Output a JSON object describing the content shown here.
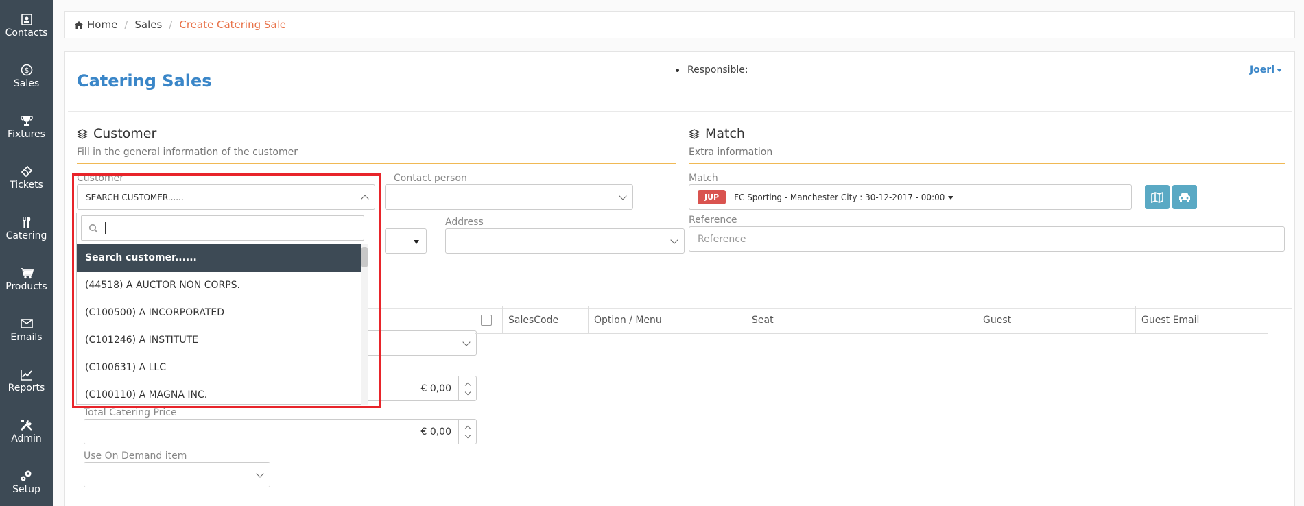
{
  "sidebar": {
    "items": [
      {
        "label": "Contacts",
        "icon": "contact-book-icon"
      },
      {
        "label": "Sales",
        "icon": "dollar-icon"
      },
      {
        "label": "Fixtures",
        "icon": "trophy-icon"
      },
      {
        "label": "Tickets",
        "icon": "ticket-icon"
      },
      {
        "label": "Catering",
        "icon": "cutlery-icon"
      },
      {
        "label": "Products",
        "icon": "cart-icon"
      },
      {
        "label": "Emails",
        "icon": "envelope-icon"
      },
      {
        "label": "Reports",
        "icon": "chart-icon"
      },
      {
        "label": "Admin",
        "icon": "tools-icon"
      },
      {
        "label": "Setup",
        "icon": "gears-icon"
      }
    ]
  },
  "breadcrumb": {
    "home": "Home",
    "sales": "Sales",
    "current": "Create Catering Sale"
  },
  "header": {
    "title": "Catering Sales",
    "responsible_label": "Responsible:",
    "user": "Joeri"
  },
  "customer_section": {
    "title": "Customer",
    "subtitle": "Fill in the general information of the customer",
    "customer_label": "Customer",
    "customer_value": "SEARCH CUSTOMER......",
    "contact_label": "Contact person",
    "address_label": "Address"
  },
  "match_section": {
    "title": "Match",
    "subtitle": "Extra information",
    "match_label": "Match",
    "match_badge": "JUP",
    "match_value": "FC Sporting - Manchester City : 30-12-2017 - 00:00",
    "reference_label": "Reference",
    "reference_placeholder": "Reference"
  },
  "pricing": {
    "price_value": "€ 0,00",
    "total_label": "Total Catering Price",
    "total_value": "€ 0,00",
    "on_demand_label": "Use On Demand item"
  },
  "table": {
    "columns": [
      "SalesCode",
      "Option / Menu",
      "Seat",
      "Guest",
      "Guest Email"
    ]
  },
  "dropdown": {
    "options": [
      "Search customer......",
      "(44518) A AUCTOR NON CORPS.",
      "(C100500) A INCORPORATED",
      "(C101246) A INSTITUTE",
      "(C100631) A LLC",
      "(C100110) A MAGNA INC."
    ]
  },
  "colors": {
    "sidebar": "#3d4a55",
    "accent": "#3a86c8",
    "highlight": "#e8242a",
    "crumb_active": "#e8734a"
  }
}
